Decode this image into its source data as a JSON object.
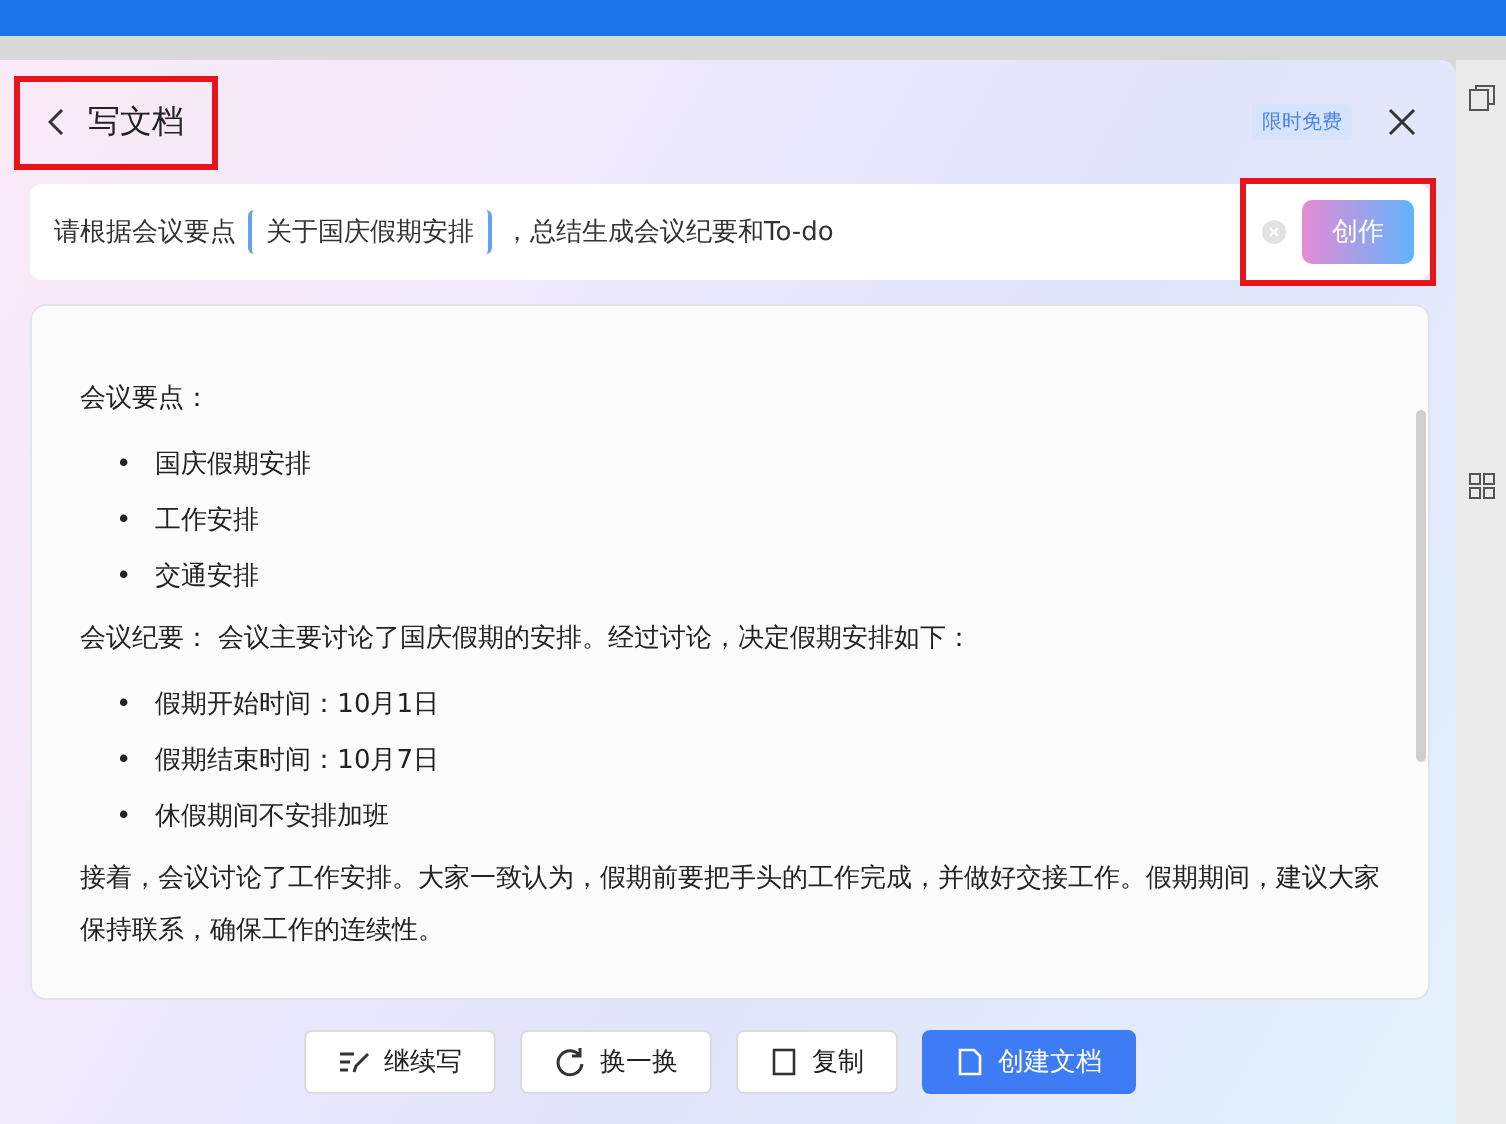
{
  "dialog": {
    "title": "写文档",
    "badge": "限时免费",
    "highlight_title": true,
    "highlight_action": true
  },
  "prompt": {
    "prefix": "请根据会议要点",
    "chip": "关于国庆假期安排",
    "suffix": "，总结生成会议纪要和To-do",
    "action": "创作"
  },
  "content": [
    {
      "kind": "para",
      "text": "会议要点："
    },
    {
      "kind": "list",
      "bullet": "•",
      "items": [
        "国庆假期安排",
        "工作安排",
        "交通安排"
      ]
    },
    {
      "kind": "para",
      "text": "会议纪要：  会议主要讨论了国庆假期的安排。经过讨论，决定假期安排如下："
    },
    {
      "kind": "list",
      "bullet": "•",
      "items": [
        "假期开始时间：10月1日",
        "假期结束时间：10月7日",
        "休假期间不安排加班"
      ]
    },
    {
      "kind": "para",
      "text": "接着，会议讨论了工作安排。大家一致认为，假期前要把手头的工作完成，并做好交接工作。假期期间，建议大家保持联系，确保工作的连续性。"
    }
  ],
  "buttons": [
    {
      "kind": "continue",
      "label": "继续写"
    },
    {
      "kind": "refresh",
      "label": "换一换"
    },
    {
      "kind": "copy",
      "label": "复制"
    },
    {
      "kind": "primary",
      "label": "创建文档"
    }
  ]
}
